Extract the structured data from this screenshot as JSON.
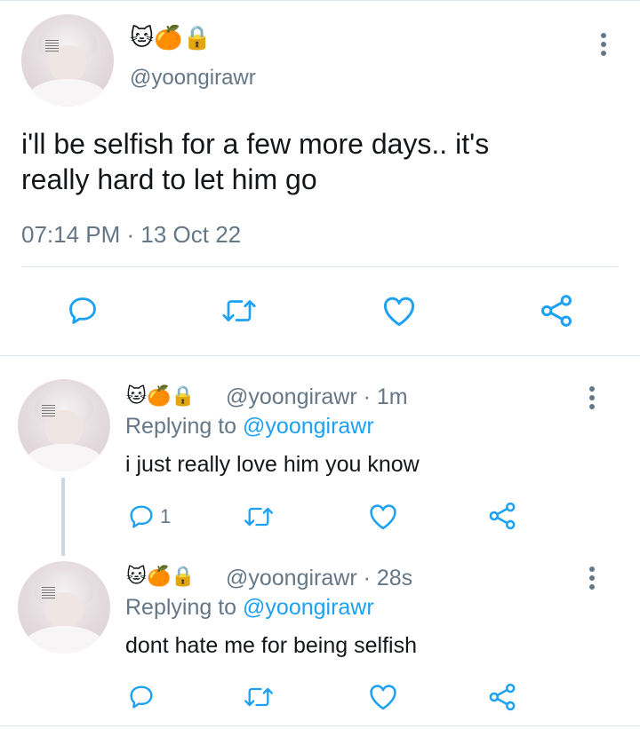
{
  "main_tweet": {
    "badges": [
      "🐱",
      "🍊",
      "🔒"
    ],
    "handle": "@yoongirawr",
    "text_line1": "i'll be selfish for a few more days.. it's",
    "text_line2": "really hard to let him go",
    "timestamp": "07:14 PM · 13 Oct 22",
    "actions": [
      "reply-icon",
      "retweet-icon",
      "like-icon",
      "share-icon"
    ]
  },
  "replies": [
    {
      "badges": [
        "🐱",
        "🍊",
        "🔒"
      ],
      "handle": "@yoongirawr",
      "time": " · 1m",
      "replying_prefix": "Replying to ",
      "replying_to": "@yoongirawr",
      "text": "i just really love him you know",
      "reply_count": "1"
    },
    {
      "badges": [
        "🐱",
        "🍊",
        "🔒"
      ],
      "handle": "@yoongirawr",
      "time": " · 28s",
      "replying_prefix": "Replying to ",
      "replying_to": "@yoongirawr",
      "text": "dont hate me for being selfish",
      "reply_count": ""
    }
  ],
  "colors": {
    "text": "#14171a",
    "muted": "#657786",
    "accent": "#1da1f2",
    "divider": "#e1e8ed"
  }
}
